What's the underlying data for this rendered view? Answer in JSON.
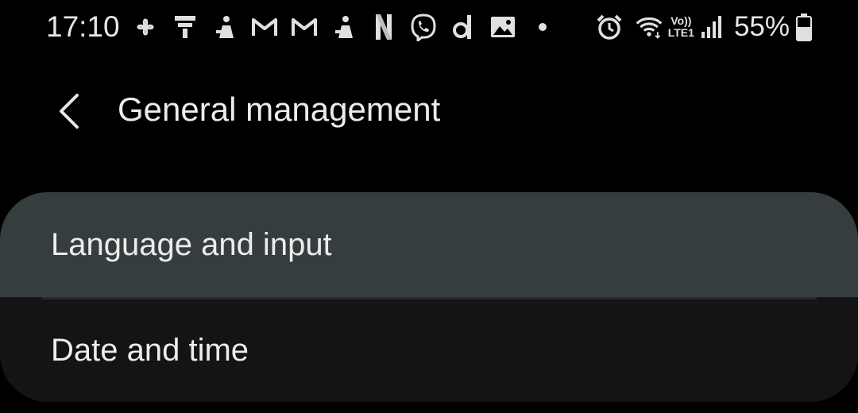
{
  "status_bar": {
    "time": "17:10",
    "notification_icons": [
      "fan-icon",
      "flag-icon",
      "game-icon",
      "gmail-icon",
      "gmail-icon",
      "game-icon",
      "netflix-icon",
      "viber-icon",
      "d-app-icon",
      "gallery-icon",
      "dot-icon"
    ],
    "volte_label": "Vo))",
    "lte_label": "LTE1",
    "battery_percent": "55%"
  },
  "header": {
    "title": "General management"
  },
  "settings": {
    "items": [
      {
        "label": "Language and input",
        "highlighted": true
      },
      {
        "label": "Date and time",
        "highlighted": false
      }
    ]
  },
  "colors": {
    "background": "#000000",
    "highlight": "#363d3f",
    "card": "#141414",
    "text": "#ececec"
  }
}
